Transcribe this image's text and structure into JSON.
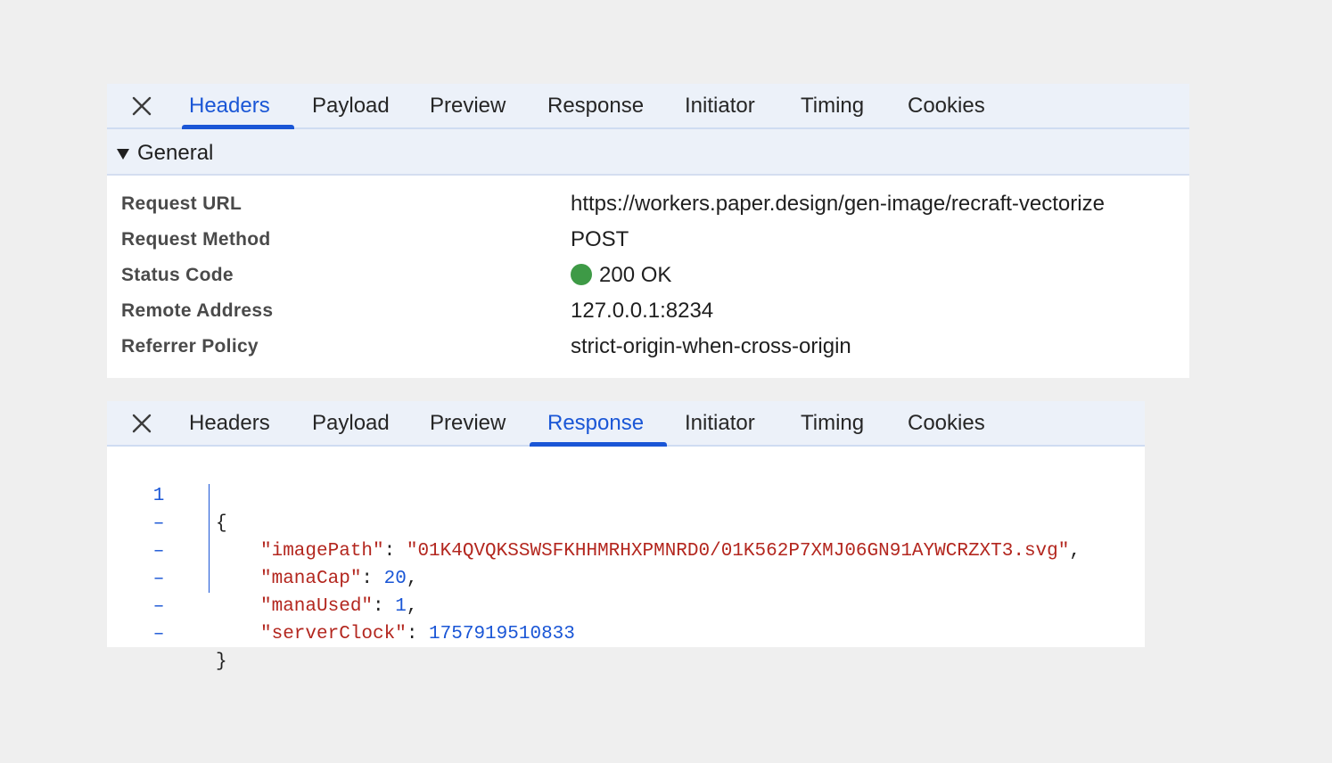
{
  "panels": [
    {
      "tabs": [
        "Headers",
        "Payload",
        "Preview",
        "Response",
        "Initiator",
        "Timing",
        "Cookies"
      ],
      "active_tab": "Headers"
    },
    {
      "tabs": [
        "Headers",
        "Payload",
        "Preview",
        "Response",
        "Initiator",
        "Timing",
        "Cookies"
      ],
      "active_tab": "Response"
    }
  ],
  "icons": {
    "close": "close-icon",
    "collapse": "caret-down-icon",
    "status": "status-dot"
  },
  "colors": {
    "accent": "#1a56d6",
    "status_ok": "#3e9a46",
    "string": "#b3261e",
    "tabbar_bg": "#ecf1f9"
  },
  "general": {
    "title": "General",
    "rows": [
      {
        "key": "Request URL",
        "value": "https://workers.paper.design/gen-image/recraft-vectorize"
      },
      {
        "key": "Request Method",
        "value": "POST"
      },
      {
        "key": "Status Code",
        "value": "200 OK"
      },
      {
        "key": "Remote Address",
        "value": "127.0.0.1:8234"
      },
      {
        "key": "Referrer Policy",
        "value": "strict-origin-when-cross-origin"
      }
    ]
  },
  "response": {
    "gutter": [
      "1",
      "–",
      "–",
      "–",
      "–",
      "–"
    ],
    "open_brace": "{",
    "close_brace": "}",
    "fields": [
      {
        "key": "\"imagePath\"",
        "sep": ": ",
        "value": "\"01K4QVQKSSWSFKHHMRHXPMNRD0/01K562P7XMJ06GN91AYWCRZXT3.svg\"",
        "type": "string",
        "trail": ","
      },
      {
        "key": "\"manaCap\"",
        "sep": ": ",
        "value": "20",
        "type": "number",
        "trail": ","
      },
      {
        "key": "\"manaUsed\"",
        "sep": ": ",
        "value": "1",
        "type": "number",
        "trail": ","
      },
      {
        "key": "\"serverClock\"",
        "sep": ": ",
        "value": "1757919510833",
        "type": "number",
        "trail": ""
      }
    ]
  }
}
